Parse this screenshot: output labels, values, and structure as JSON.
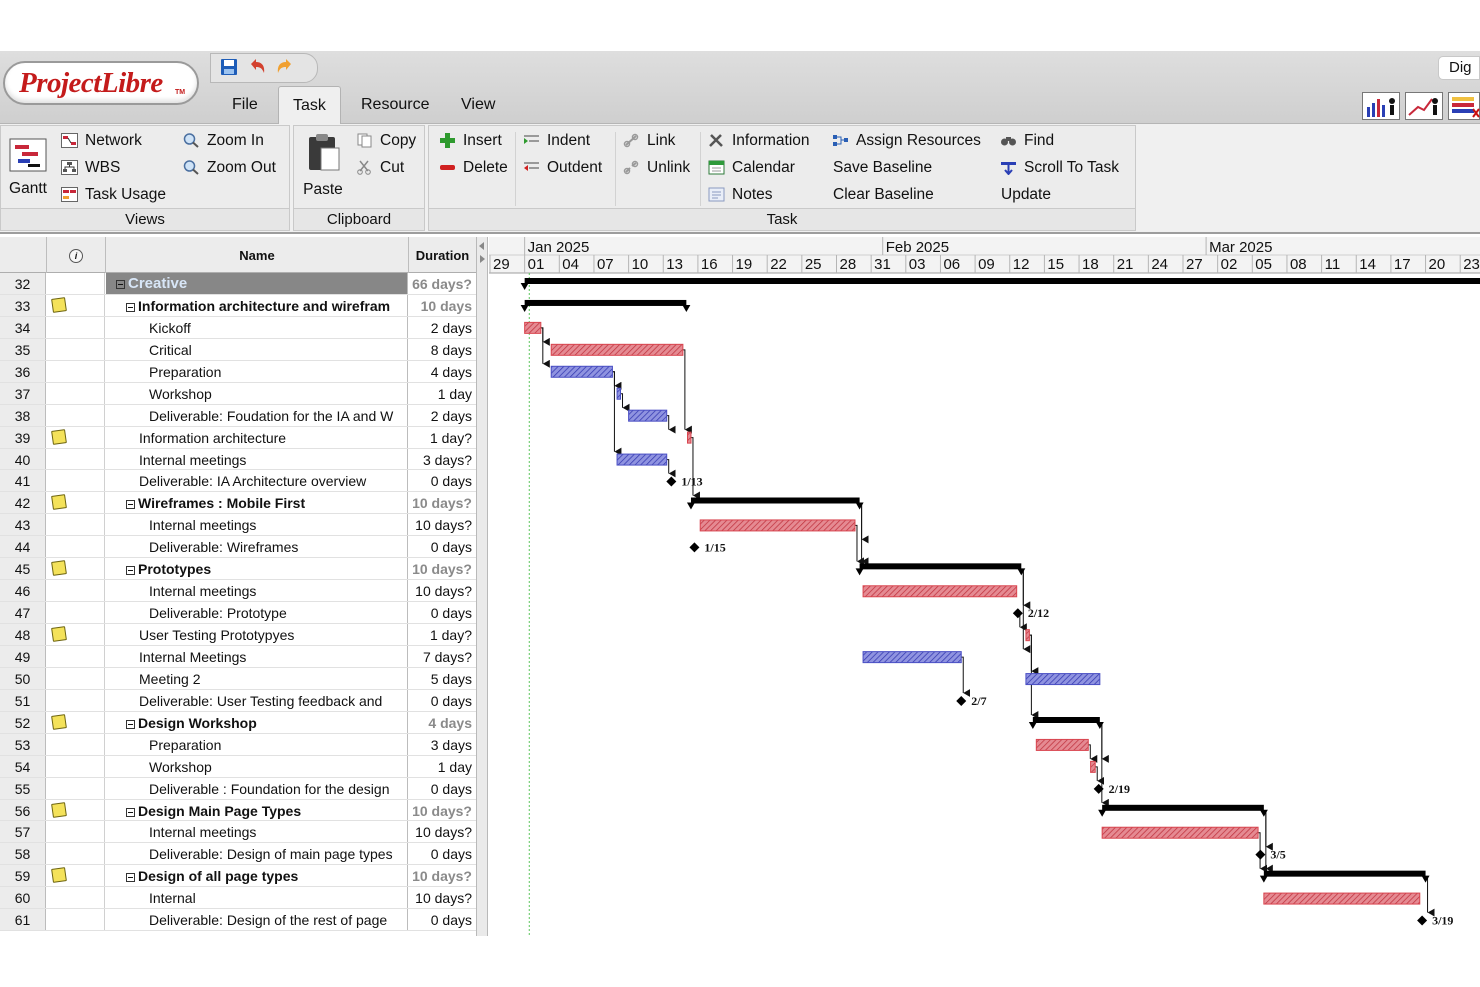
{
  "app": {
    "logo_text": "ProjectLibre",
    "logo_tm": "TM",
    "right_button": "Dig"
  },
  "menu_tabs": [
    {
      "label": "File",
      "active": false
    },
    {
      "label": "Task",
      "active": true
    },
    {
      "label": "Resource",
      "active": false
    },
    {
      "label": "View",
      "active": false
    }
  ],
  "ribbon": {
    "views": {
      "title": "Views",
      "gantt": "Gantt",
      "network": "Network",
      "wbs": "WBS",
      "task_usage": "Task Usage",
      "zoom_in": "Zoom In",
      "zoom_out": "Zoom Out"
    },
    "clipboard": {
      "title": "Clipboard",
      "paste": "Paste",
      "copy": "Copy",
      "cut": "Cut"
    },
    "task": {
      "title": "Task",
      "insert": "Insert",
      "delete": "Delete",
      "indent": "Indent",
      "outdent": "Outdent",
      "link": "Link",
      "unlink": "Unlink",
      "information": "Information",
      "calendar": "Calendar",
      "notes": "Notes",
      "assign_resources": "Assign Resources",
      "save_baseline": "Save Baseline",
      "clear_baseline": "Clear Baseline",
      "find": "Find",
      "scroll_to_task": "Scroll To Task",
      "update": "Update"
    }
  },
  "table": {
    "columns": {
      "indicators": "i",
      "name": "Name",
      "duration": "Duration"
    },
    "rows": [
      {
        "id": "32",
        "name": "Creative",
        "duration": "66 days?",
        "level": 0,
        "type": "root",
        "note": false
      },
      {
        "id": "33",
        "name": "Information architecture and wirefram",
        "duration": "10 days",
        "level": 1,
        "type": "summary",
        "note": true
      },
      {
        "id": "34",
        "name": "Kickoff",
        "duration": "2 days",
        "level": 2,
        "type": "task",
        "note": false
      },
      {
        "id": "35",
        "name": "Critical",
        "duration": "8 days",
        "level": 2,
        "type": "task",
        "note": false
      },
      {
        "id": "36",
        "name": "Preparation",
        "duration": "4 days",
        "level": 2,
        "type": "task",
        "note": false
      },
      {
        "id": "37",
        "name": "Workshop",
        "duration": "1 day",
        "level": 2,
        "type": "task",
        "note": false
      },
      {
        "id": "38",
        "name": "Deliverable: Foudation for the IA and W",
        "duration": "2 days",
        "level": 2,
        "type": "task",
        "note": false
      },
      {
        "id": "39",
        "name": "Information architecture",
        "duration": "1 day?",
        "level": 1,
        "type": "task",
        "note": true
      },
      {
        "id": "40",
        "name": "Internal meetings",
        "duration": "3 days?",
        "level": 1,
        "type": "task",
        "note": false
      },
      {
        "id": "41",
        "name": "Deliverable: IA Architecture overview",
        "duration": "0 days",
        "level": 1,
        "type": "task",
        "note": false
      },
      {
        "id": "42",
        "name": "Wireframes : Mobile First",
        "duration": "10 days?",
        "level": 1,
        "type": "summary",
        "note": true
      },
      {
        "id": "43",
        "name": "Internal meetings",
        "duration": "10 days?",
        "level": 2,
        "type": "task",
        "note": false
      },
      {
        "id": "44",
        "name": "Deliverable: Wireframes",
        "duration": "0 days",
        "level": 2,
        "type": "task",
        "note": false
      },
      {
        "id": "45",
        "name": "Prototypes",
        "duration": "10 days?",
        "level": 1,
        "type": "summary",
        "note": true
      },
      {
        "id": "46",
        "name": "Internal meetings",
        "duration": "10 days?",
        "level": 2,
        "type": "task",
        "note": false
      },
      {
        "id": "47",
        "name": "Deliverable: Prototype",
        "duration": "0 days",
        "level": 2,
        "type": "task",
        "note": false
      },
      {
        "id": "48",
        "name": "User Testing Prototypyes",
        "duration": "1 day?",
        "level": 1,
        "type": "task",
        "note": true
      },
      {
        "id": "49",
        "name": "Internal Meetings",
        "duration": "7 days?",
        "level": 1,
        "type": "task",
        "note": false
      },
      {
        "id": "50",
        "name": "Meeting 2",
        "duration": "5 days",
        "level": 1,
        "type": "task",
        "note": false
      },
      {
        "id": "51",
        "name": "Deliverable: User Testing feedback and",
        "duration": "0 days",
        "level": 1,
        "type": "task",
        "note": false
      },
      {
        "id": "52",
        "name": "Design Workshop",
        "duration": "4 days",
        "level": 1,
        "type": "summary",
        "note": true
      },
      {
        "id": "53",
        "name": "Preparation",
        "duration": "3 days",
        "level": 2,
        "type": "task",
        "note": false
      },
      {
        "id": "54",
        "name": "Workshop",
        "duration": "1 day",
        "level": 2,
        "type": "task",
        "note": false
      },
      {
        "id": "55",
        "name": "Deliverable : Foundation for the design",
        "duration": "0 days",
        "level": 2,
        "type": "task",
        "note": false
      },
      {
        "id": "56",
        "name": "Design Main Page Types",
        "duration": "10 days?",
        "level": 1,
        "type": "summary",
        "note": true
      },
      {
        "id": "57",
        "name": "Internal meetings",
        "duration": "10 days?",
        "level": 2,
        "type": "task",
        "note": false
      },
      {
        "id": "58",
        "name": "Deliverable: Design of main page types",
        "duration": "0 days",
        "level": 2,
        "type": "task",
        "note": false
      },
      {
        "id": "59",
        "name": "Design of all page types",
        "duration": "10 days?",
        "level": 1,
        "type": "summary",
        "note": true
      },
      {
        "id": "60",
        "name": "Internal",
        "duration": "10 days?",
        "level": 2,
        "type": "task",
        "note": false
      },
      {
        "id": "61",
        "name": "Deliverable: Design of the rest of page",
        "duration": "0 days",
        "level": 2,
        "type": "task",
        "note": false
      }
    ]
  },
  "gantt": {
    "months": [
      {
        "label": "Jan 2025",
        "day_index": 3
      },
      {
        "label": "Feb 2025",
        "day_index": 34
      },
      {
        "label": "Mar 2025",
        "day_index": 62
      }
    ],
    "day_ticks": [
      "29",
      "01",
      "04",
      "07",
      "10",
      "13",
      "16",
      "19",
      "22",
      "25",
      "28",
      "31",
      "03",
      "06",
      "09",
      "12",
      "15",
      "18",
      "21",
      "24",
      "27",
      "02",
      "05",
      "08",
      "11",
      "14",
      "17",
      "20",
      "23"
    ],
    "colors": {
      "critical": "#d9454f",
      "normal": "#4a4fc4",
      "summary": "#000000"
    },
    "bars": [
      {
        "row": 0,
        "kind": "summary",
        "start": 3,
        "end": 86
      },
      {
        "row": 1,
        "kind": "summary",
        "start": 3,
        "end": 17
      },
      {
        "row": 2,
        "kind": "critical",
        "start": 3,
        "end": 4.4
      },
      {
        "row": 3,
        "kind": "critical",
        "start": 5.3,
        "end": 16.7
      },
      {
        "row": 4,
        "kind": "normal",
        "start": 5.3,
        "end": 10.6
      },
      {
        "row": 5,
        "kind": "normal",
        "start": 11.0,
        "end": 11.3
      },
      {
        "row": 6,
        "kind": "normal",
        "start": 12.0,
        "end": 15.3
      },
      {
        "row": 7,
        "kind": "critical",
        "start": 17.1,
        "end": 17.4
      },
      {
        "row": 8,
        "kind": "normal",
        "start": 11.0,
        "end": 15.3
      },
      {
        "row": 10,
        "kind": "summary",
        "start": 17.4,
        "end": 32
      },
      {
        "row": 11,
        "kind": "critical",
        "start": 18.2,
        "end": 31.6
      },
      {
        "row": 13,
        "kind": "summary",
        "start": 32,
        "end": 46
      },
      {
        "row": 14,
        "kind": "critical",
        "start": 32.3,
        "end": 45.6
      },
      {
        "row": 16,
        "kind": "critical",
        "start": 46.4,
        "end": 46.7
      },
      {
        "row": 17,
        "kind": "normal",
        "start": 32.3,
        "end": 40.8
      },
      {
        "row": 18,
        "kind": "normal",
        "start": 46.4,
        "end": 52.8
      },
      {
        "row": 20,
        "kind": "summary",
        "start": 47.0,
        "end": 52.8
      },
      {
        "row": 21,
        "kind": "critical",
        "start": 47.3,
        "end": 51.8
      },
      {
        "row": 22,
        "kind": "critical",
        "start": 52.0,
        "end": 52.4
      },
      {
        "row": 24,
        "kind": "summary",
        "start": 53.0,
        "end": 67.0
      },
      {
        "row": 25,
        "kind": "critical",
        "start": 53.0,
        "end": 66.5
      },
      {
        "row": 27,
        "kind": "summary",
        "start": 67.0,
        "end": 81.0
      },
      {
        "row": 28,
        "kind": "critical",
        "start": 67.0,
        "end": 80.5
      }
    ],
    "milestones": [
      {
        "row": 9,
        "at": 15.7,
        "label": "1/13"
      },
      {
        "row": 12,
        "at": 17.7,
        "label": "1/15"
      },
      {
        "row": 15,
        "at": 45.7,
        "label": "2/12"
      },
      {
        "row": 19,
        "at": 40.8,
        "label": "2/7"
      },
      {
        "row": 23,
        "at": 52.7,
        "label": "2/19"
      },
      {
        "row": 26,
        "at": 66.7,
        "label": "3/5"
      },
      {
        "row": 29,
        "at": 80.7,
        "label": "3/19"
      }
    ]
  }
}
